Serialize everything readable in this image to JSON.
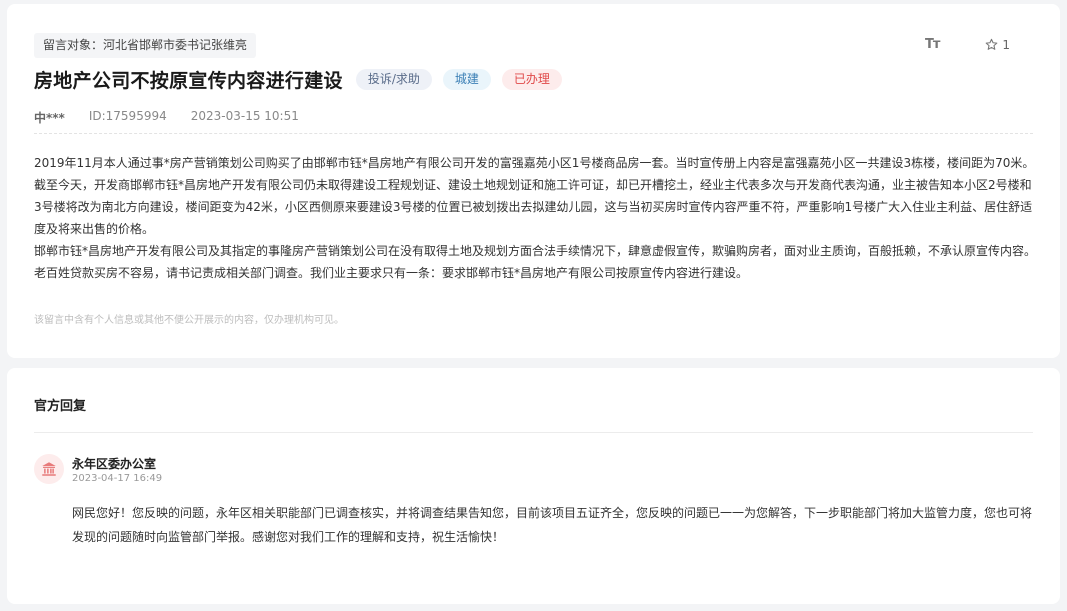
{
  "message": {
    "recipient": "留言对象：河北省邯郸市委书记张维亮",
    "font_toggle_label": "Tт",
    "favorite_count": "1",
    "title": "房地产公司不按原宣传内容进行建设",
    "tags": {
      "type": "投诉/求助",
      "category": "城建",
      "status": "已办理"
    },
    "author": "中***",
    "id": "ID:17595994",
    "datetime": "2023-03-15 10:51",
    "paragraphs": [
      "2019年11月本人通过事*房产营销策划公司购买了由邯郸市钰*昌房地产有限公司开发的富强嘉苑小区1号楼商品房一套。当时宣传册上内容是富强嘉苑小区一共建设3栋楼，楼间距为70米。截至今天，开发商邯郸市钰*昌房地产开发有限公司仍未取得建设工程规划证、建设土地规划证和施工许可证，却已开槽挖土，经业主代表多次与开发商代表沟通，业主被告知本小区2号楼和3号楼将改为南北方向建设，楼间距变为42米，小区西侧原来要建设3号楼的位置已被划拨出去拟建幼儿园，这与当初买房时宣传内容严重不符，严重影响1号楼广大入住业主利益、居住舒适度及将来出售的价格。",
      "邯郸市钰*昌房地产开发有限公司及其指定的事隆房产营销策划公司在没有取得土地及规划方面合法手续情况下，肆意虚假宣传，欺骗购房者，面对业主质询，百般抵赖，不承认原宣传内容。老百姓贷款买房不容易，请书记责成相关部门调查。我们业主要求只有一条：要求邯郸市钰*昌房地产有限公司按原宣传内容进行建设。"
    ],
    "privacy_note": "该留言中含有个人信息或其他不便公开展示的内容，仅办理机构可见。"
  },
  "reply": {
    "heading": "官方回复",
    "org_name": "永年区委办公室",
    "datetime": "2023-04-17 16:49",
    "body": "网民您好！您反映的问题，永年区相关职能部门已调查核实，并将调查结果告知您，目前该项目五证齐全，您反映的问题已一一为您解答，下一步职能部门将加大监管力度，您也可将发现的问题随时向监管部门举报。感谢您对我们工作的理解和支持，祝生活愉快！"
  },
  "icons": {
    "favorite": "star-icon",
    "organization": "government-building-icon"
  },
  "colors": {
    "status_red": "#e04a4a",
    "category_blue": "#3a7fb5",
    "type_gray": "#5a6c8a"
  }
}
